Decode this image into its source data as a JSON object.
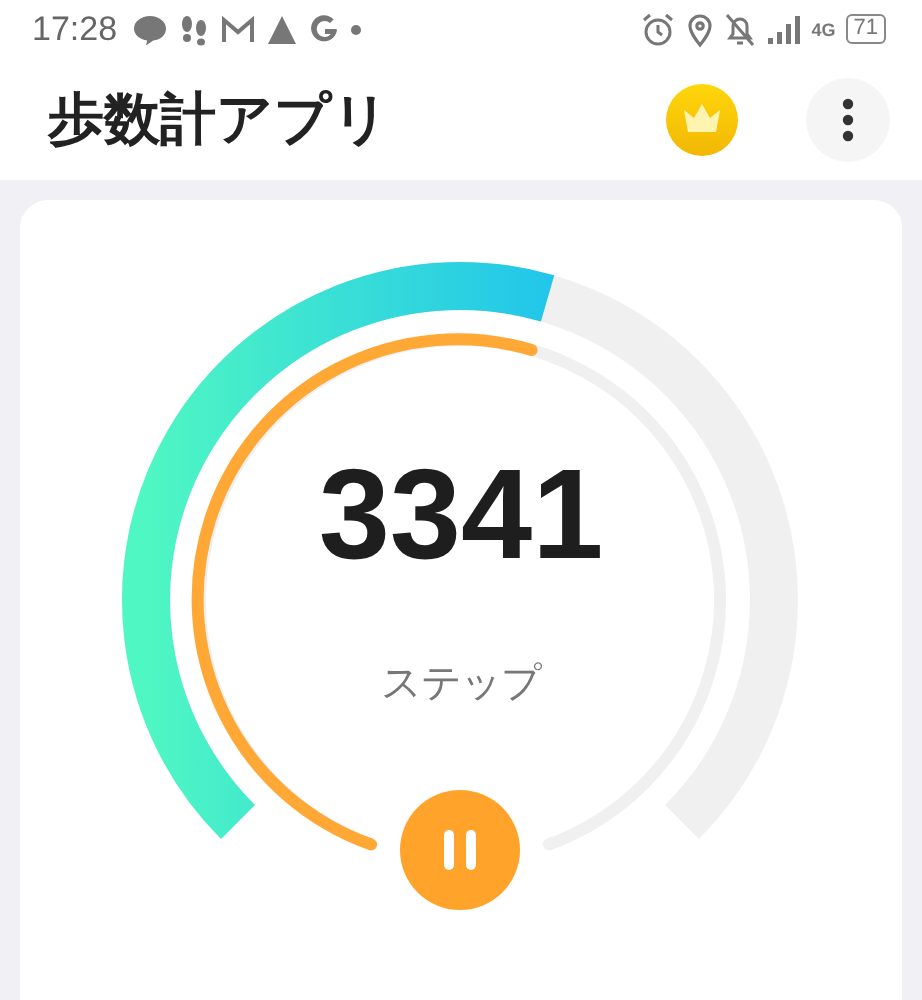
{
  "status_bar": {
    "time": "17:28",
    "network": "4G",
    "battery": "71"
  },
  "header": {
    "title": "歩数計アプリ"
  },
  "counter": {
    "steps": "3341",
    "unit": "ステップ",
    "paused": false
  }
}
